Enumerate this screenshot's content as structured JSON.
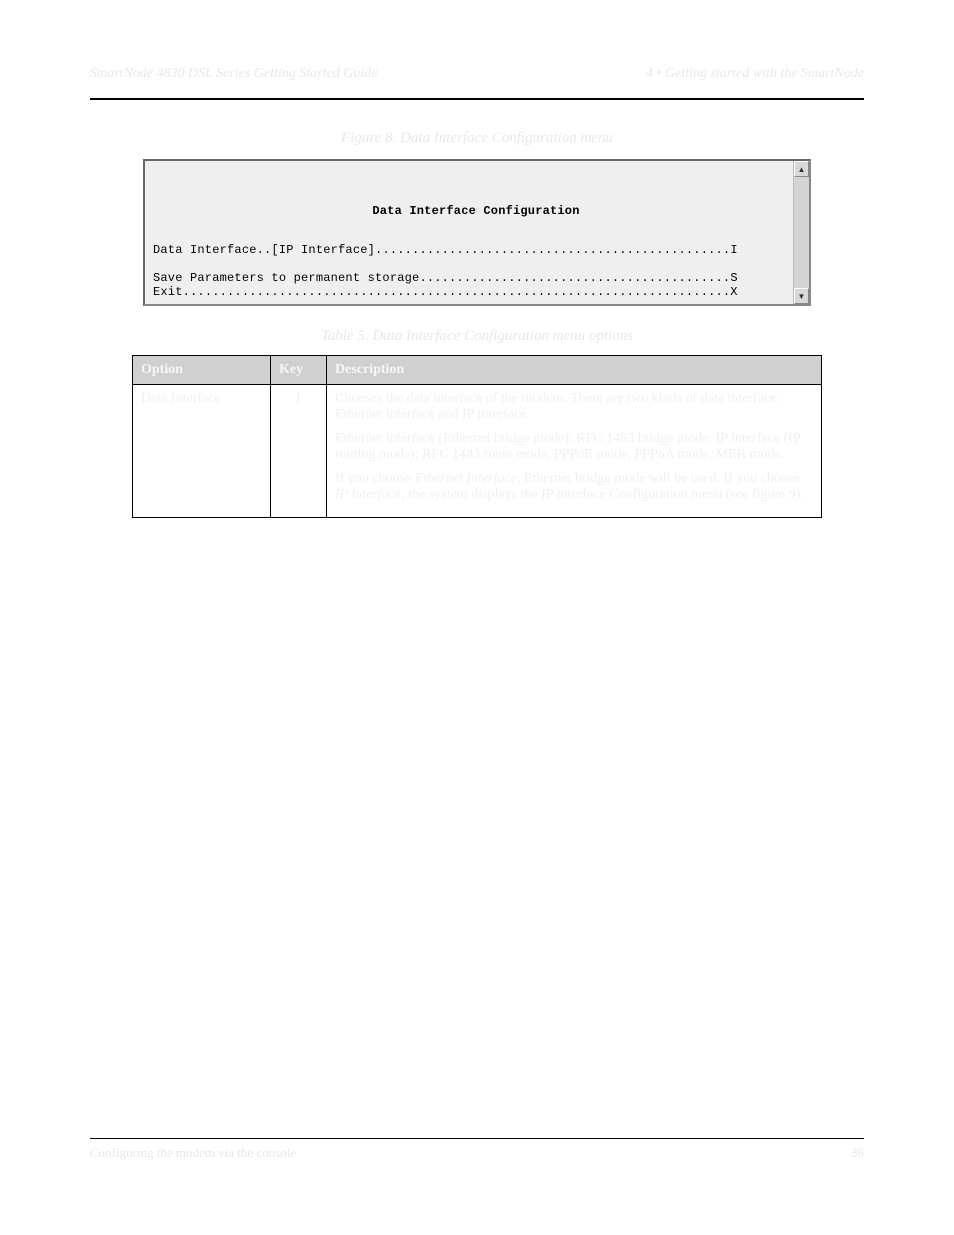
{
  "header": {
    "left": "SmartNode 4830 DSL Series Getting Started Guide",
    "right": "4 • Getting started with the SmartNode"
  },
  "figure": {
    "caption": "Figure 8. Data Interface Configuration menu",
    "terminal": {
      "title": "Data Interface Configuration",
      "line1_label": "Data Interface..[IP Interface]",
      "line1_key": "I",
      "line2_label": "Save Parameters to permanent storage",
      "line2_key": "S",
      "line3_label": "Exit",
      "line3_key": "X"
    }
  },
  "table": {
    "caption": "Table 5. Data Interface Configuration menu options",
    "headers": {
      "c1": "Option",
      "c2": "Key",
      "c3": "Description"
    },
    "row1": {
      "option": "Data Interface",
      "key": "I",
      "p1": "Chooses the data interface of the modem. There are two kinds of data interface: Ethernet interface and IP interface.",
      "p2": "Ethernet interface (Ethernet bridge mode): RFC 1483 bridge mode; IP interface (IP routing mode): RFC 1483 route mode, PPPoE mode, PPPoA mode, MER mode.",
      "p3_before": "If you choose ",
      "p3_em1": "Ethernet Interface",
      "p3_mid1": ", Ethernet bridge mode will be used. If you choose ",
      "p3_em2": "IP interface",
      "p3_mid2": ", the system displays the IP interface Configuration menu (see figure 9)."
    }
  },
  "footer": {
    "left": "Configuring the modem via the console",
    "right": "36"
  }
}
